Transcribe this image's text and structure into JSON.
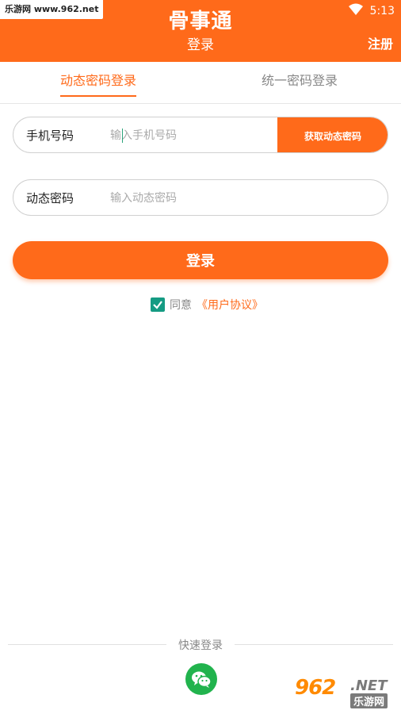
{
  "watermark_top": "乐游网 www.962.net",
  "status_bar": {
    "time": "5:13"
  },
  "header": {
    "title": "骨事通",
    "subtitle": "登录",
    "register": "注册"
  },
  "tabs": [
    {
      "label": "动态密码登录",
      "active": true
    },
    {
      "label": "统一密码登录",
      "active": false
    }
  ],
  "phone_field": {
    "label": "手机号码",
    "placeholder": "输入手机号码",
    "value": ""
  },
  "code_button": "获取动态密码",
  "code_field": {
    "label": "动态密码",
    "placeholder": "输入动态密码",
    "value": ""
  },
  "login_button": "登录",
  "agreement": {
    "checked": true,
    "prefix": "同意",
    "link": "《用户协议》"
  },
  "quick_login": {
    "label": "快速登录"
  },
  "watermark_bottom": {
    "number": "962",
    "suffix": ".NET",
    "name": "乐游网"
  },
  "colors": {
    "primary": "#ff6a1a",
    "checkbox": "#159b83",
    "wechat": "#21b34d"
  }
}
